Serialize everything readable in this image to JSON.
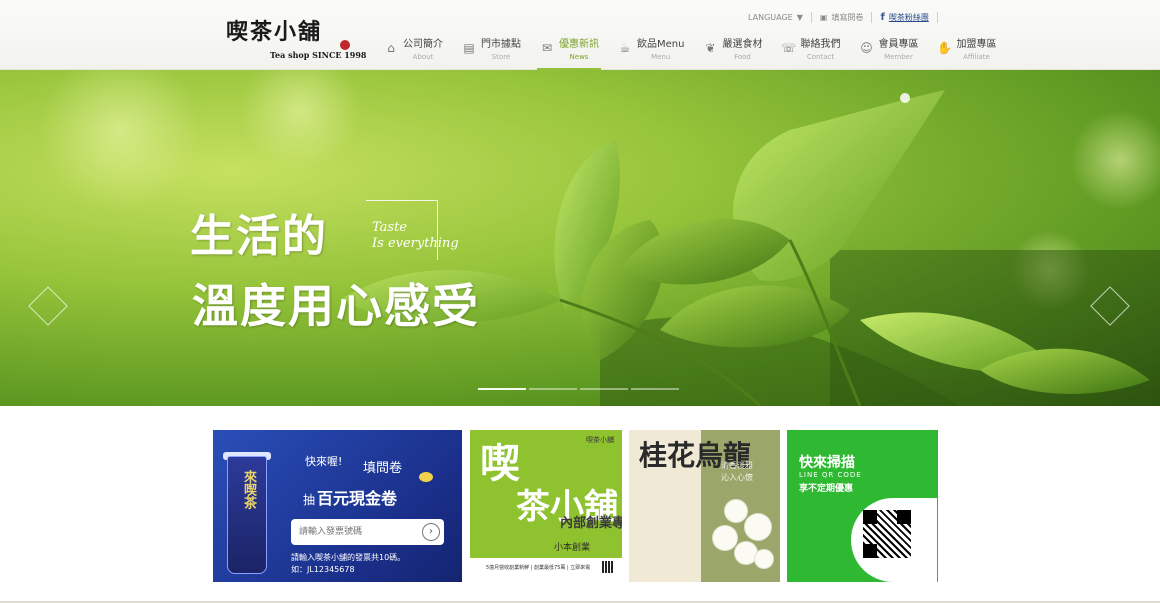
{
  "colors": {
    "accent": "#93c13d",
    "nav_active": "#7aa22a",
    "hero_green": "#96c43a",
    "banner_blue": "#1f3a9a",
    "banner_lime": "#8ec22f",
    "banner_line_green": "#2fb932"
  },
  "logo": {
    "chars": "喫茶小舖",
    "tagline": "Tea shop SINCE 1998"
  },
  "topbar": {
    "language": "LANGUAGE",
    "language_caret": "▼",
    "survey": "填寫問卷",
    "facebook_label": "喫茶粉絲團"
  },
  "nav": [
    {
      "zh": "公司簡介",
      "en": "About",
      "icon": "house-icon",
      "glyph": "⌂"
    },
    {
      "zh": "門市據點",
      "en": "Store",
      "icon": "store-icon",
      "glyph": "▤"
    },
    {
      "zh": "優惠新訊",
      "en": "News",
      "icon": "news-icon",
      "glyph": "✉"
    },
    {
      "zh": "飲品Menu",
      "en": "Menu",
      "icon": "cup-icon",
      "glyph": "☕"
    },
    {
      "zh": "嚴選食材",
      "en": "Food",
      "icon": "leaf-icon",
      "glyph": "❦"
    },
    {
      "zh": "聯絡我們",
      "en": "Contact",
      "icon": "contact-icon",
      "glyph": "☏"
    },
    {
      "zh": "會員專區",
      "en": "Member",
      "icon": "member-icon",
      "glyph": "☺"
    },
    {
      "zh": "加盟專區",
      "en": "Affiliate",
      "icon": "handshake-icon",
      "glyph": "✋"
    }
  ],
  "hero": {
    "slogan_line1": "生活的",
    "slogan_line2": "溫度用心感受",
    "taste_line1": "Taste",
    "taste_line2": "Is everything",
    "active_slide": 0,
    "slide_count": 4,
    "prev_glyph": "‹",
    "next_glyph": "›"
  },
  "banners": {
    "survey": {
      "cup_text": "來喫茶",
      "bubble": "快來喔!",
      "title": "填問卷",
      "title2_prefix": "抽",
      "title2": "百元現金卷",
      "input_placeholder": "請輸入發票號碼",
      "go_glyph": "›",
      "note_line1": "請輸入喫茶小舖的發票共10碼。",
      "note_line2": "如：JL12345678"
    },
    "franchise": {
      "top": "喫茶小舖",
      "big1": "喫",
      "big2": "茶小舖",
      "small": "內部創業專案",
      "sub": "小本創業",
      "strip": "5億月營收創業新鮮 | 創業最低75萬 | 立即來電"
    },
    "osmanthus": {
      "title": "桂花烏龍",
      "poem_line1": "清香淡雅",
      "poem_line2": "沁入心懷"
    },
    "line": {
      "title": "快來掃描",
      "sub": "LINE QR CODE",
      "sub2": "享不定期優惠"
    }
  }
}
